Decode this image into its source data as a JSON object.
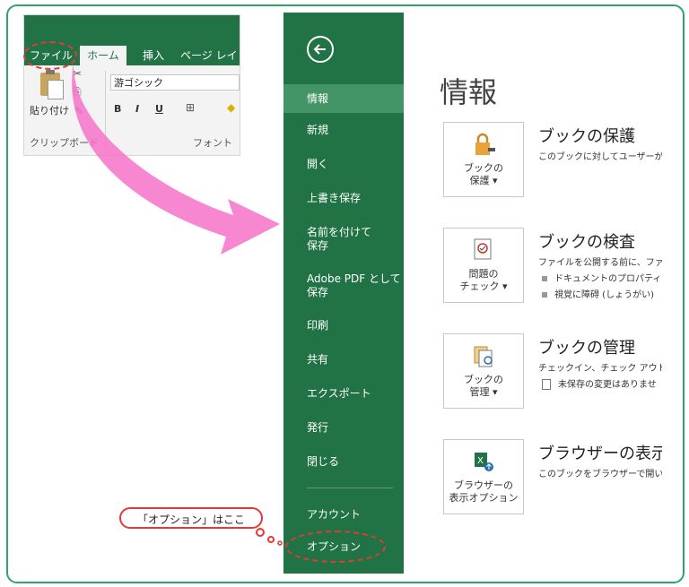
{
  "ribbon": {
    "tabs": {
      "file": "ファイル",
      "home": "ホーム",
      "insert": "挿入",
      "page_layout": "ページ レイ"
    },
    "paste_label": "貼り付け",
    "font_name": "游ゴシック",
    "format_buttons": {
      "bold": "B",
      "italic": "I",
      "underline": "U"
    },
    "groups": {
      "clipboard": "クリップボード",
      "font": "フォント"
    }
  },
  "backstage": {
    "nav": {
      "info": "情報",
      "new": "新規",
      "open": "開く",
      "save": "上書き保存",
      "save_as": "名前を付けて\n保存",
      "save_pdf": "Adobe PDF として\n保存",
      "print": "印刷",
      "share": "共有",
      "export": "エクスポート",
      "publish": "発行",
      "close": "閉じる",
      "account": "アカウント",
      "options": "オプション"
    },
    "page_title": "情報",
    "sections": {
      "protect": {
        "tile": "ブックの\n保護 ▾",
        "title": "ブックの保護",
        "desc": "このブックに対してユーザーが実"
      },
      "inspect": {
        "tile": "問題の\nチェック ▾",
        "title": "ブックの検査",
        "desc": "ファイルを公開する前に、ファイ",
        "bullet1": "ドキュメントのプロパティ、",
        "bullet2": "視覚に障碍 (しょうがい)"
      },
      "manage": {
        "tile": "ブックの\n管理 ▾",
        "title": "ブックの管理",
        "desc": "チェックイン、チェック アウト、未",
        "bullet1": "未保存の変更はありませ"
      },
      "browser": {
        "tile": "ブラウザーの\n表示オプション",
        "title": "ブラウザーの表示オ",
        "desc": "このブックをブラウザーで開いた"
      }
    }
  },
  "callout": {
    "text": "「オプション」はここ"
  },
  "colors": {
    "excel_green": "#217346",
    "nav_selected": "#439467",
    "annotation_red": "#e53935",
    "arrow_pink": "#f472c8",
    "frame_green": "#2ea66a"
  }
}
